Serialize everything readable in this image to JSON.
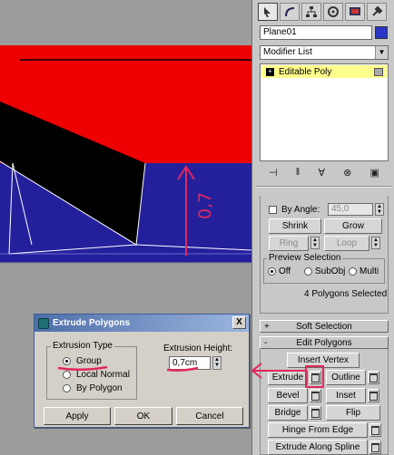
{
  "annotation": {
    "label": "0,7"
  },
  "panel": {
    "tab_icons": [
      "pointer-icon",
      "bend-icon",
      "hierarchy-icon",
      "motion-icon",
      "display-icon",
      "utilities-icon"
    ],
    "object_name": "Plane01",
    "object_color": "#2b36c4",
    "modifier_list_label": "Modifier List",
    "stack_item_label": "Editable Poly",
    "stack_item_plus": "+",
    "by_angle": {
      "label": "By Angle:",
      "value": "45,0"
    },
    "shrink_label": "Shrink",
    "grow_label": "Grow",
    "ring_label": "Ring",
    "loop_label": "Loop",
    "preview_selection": {
      "title": "Preview Selection",
      "options": [
        "Off",
        "SubObj",
        "Multi"
      ],
      "selected": "Off"
    },
    "selection_status": "4 Polygons Selected",
    "soft_selection": {
      "sign": "+",
      "label": "Soft Selection"
    },
    "edit_polygons": {
      "sign": "-",
      "label": "Edit Polygons"
    },
    "insert_vertex_label": "Insert Vertex",
    "extrude_label": "Extrude",
    "outline_label": "Outline",
    "bevel_label": "Bevel",
    "inset_label": "Inset",
    "bridge_label": "Bridge",
    "flip_label": "Flip",
    "hinge_label": "Hinge From Edge",
    "extrude_spline_label": "Extrude Along Spline"
  },
  "dialog": {
    "title": "Extrude Polygons",
    "close_label": "X",
    "extrusion_type": {
      "title": "Extrusion Type",
      "options": [
        "Group",
        "Local Normal",
        "By Polygon"
      ],
      "selected": "Group"
    },
    "extrusion_height": {
      "label": "Extrusion Height:",
      "value": "0,7cm"
    },
    "apply_label": "Apply",
    "ok_label": "OK",
    "cancel_label": "Cancel"
  },
  "colors": {
    "red_face": "#ee0000",
    "blue_face": "#24209c",
    "annotation": "#e0285a",
    "stack_highlight": "#ffff8c"
  }
}
